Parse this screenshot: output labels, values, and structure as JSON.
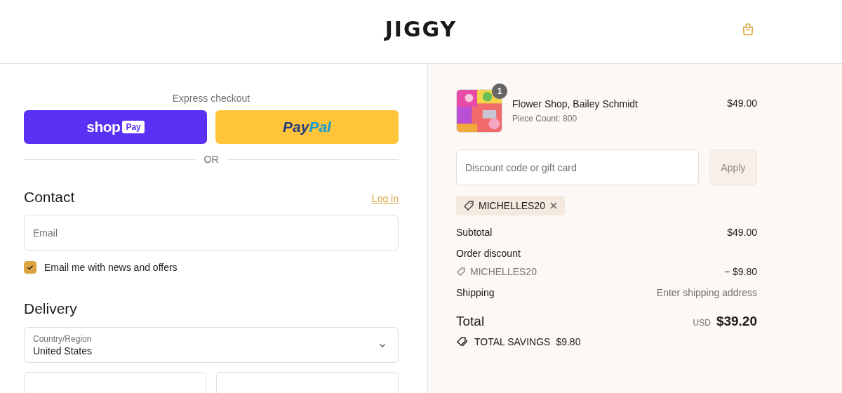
{
  "header": {
    "logo": "JIGGY"
  },
  "express": {
    "title": "Express checkout",
    "shop_pay": {
      "word": "shop",
      "badge": "Pay"
    },
    "paypal": {
      "parts": [
        "Pay",
        "Pal"
      ]
    },
    "divider": "OR"
  },
  "contact": {
    "heading": "Contact",
    "login": "Log in",
    "email": {
      "placeholder": "Email"
    },
    "newsletter": {
      "label": "Email me with news and offers",
      "checked": true
    }
  },
  "delivery": {
    "heading": "Delivery",
    "country": {
      "label": "Country/Region",
      "value": "United States"
    }
  },
  "summary": {
    "items": [
      {
        "title": "Flower Shop, Bailey Schmidt",
        "detail": "Piece Count: 800",
        "quantity": "1",
        "price": "$49.00"
      }
    ],
    "discount": {
      "placeholder": "Discount code or gift card",
      "button": "Apply",
      "applied": "MICHELLES20"
    },
    "lines": [
      {
        "kind": "plain",
        "label": "Subtotal",
        "value": "$49.00"
      },
      {
        "kind": "discount",
        "label": "Order discount",
        "code": "MICHELLES20",
        "value": "− $9.80"
      },
      {
        "kind": "muted",
        "label": "Shipping",
        "value": "Enter shipping address"
      }
    ],
    "total": {
      "label": "Total",
      "currency": "USD",
      "value": "$39.20"
    },
    "savings": {
      "label": "TOTAL SAVINGS",
      "value": "$9.80"
    }
  }
}
